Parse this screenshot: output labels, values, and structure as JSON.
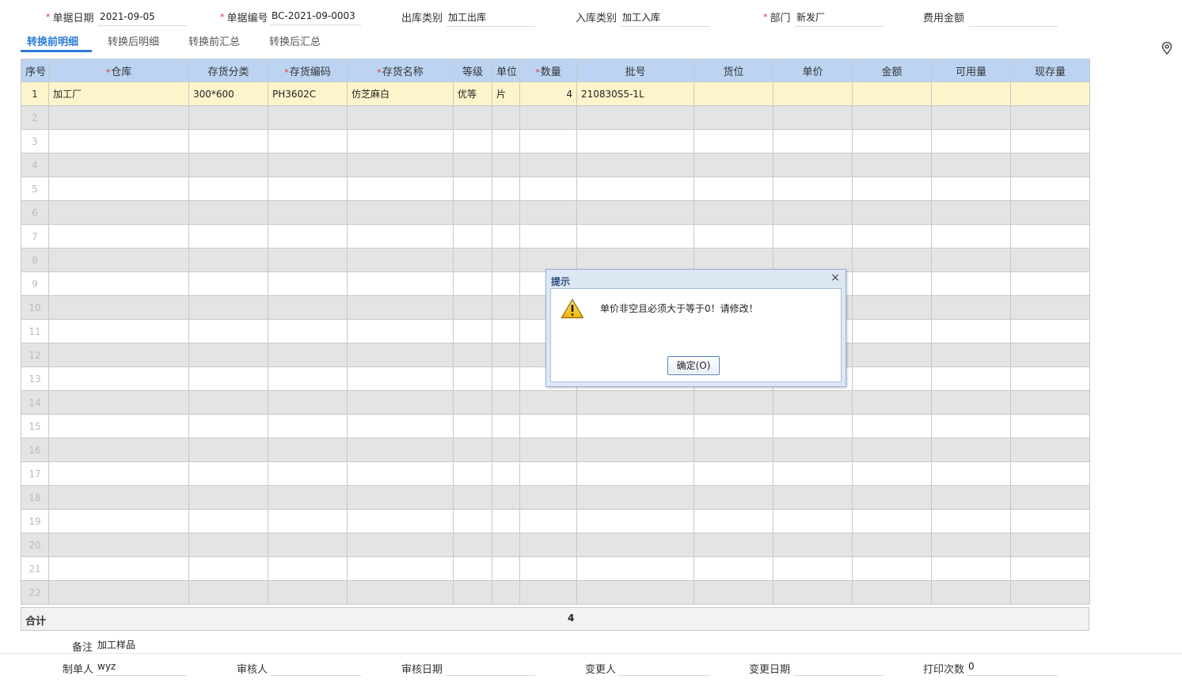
{
  "header": {
    "date": {
      "label": "单据日期",
      "value": "2021-09-05",
      "required": true
    },
    "code": {
      "label": "单据编号",
      "value": "BC-2021-09-0003",
      "required": true
    },
    "out_type": {
      "label": "出库类别",
      "value": "加工出库",
      "required": false
    },
    "in_type": {
      "label": "入库类别",
      "value": "加工入库",
      "required": false
    },
    "dept": {
      "label": "部门",
      "value": "新发厂",
      "required": true
    },
    "fee": {
      "label": "费用金额",
      "value": "",
      "required": false
    }
  },
  "tabs": [
    "转换前明细",
    "转换后明细",
    "转换前汇总",
    "转换后汇总"
  ],
  "active_tab": 0,
  "table": {
    "columns": [
      {
        "label": "序号",
        "required": false
      },
      {
        "label": "仓库",
        "required": true
      },
      {
        "label": "存货分类",
        "required": false
      },
      {
        "label": "存货编码",
        "required": true
      },
      {
        "label": "存货名称",
        "required": true
      },
      {
        "label": "等级",
        "required": false
      },
      {
        "label": "单位",
        "required": false
      },
      {
        "label": "数量",
        "required": true
      },
      {
        "label": "批号",
        "required": false
      },
      {
        "label": "货位",
        "required": false
      },
      {
        "label": "单价",
        "required": false
      },
      {
        "label": "金额",
        "required": false
      },
      {
        "label": "可用量",
        "required": false
      },
      {
        "label": "现存量",
        "required": false
      }
    ],
    "rows": [
      [
        "1",
        "加工厂",
        "300*600",
        "PH3602C",
        "仿芝麻白",
        "优等",
        "片",
        "4",
        "210830S5-1L",
        "",
        "",
        "",
        "",
        ""
      ],
      [
        "2",
        "",
        "",
        "",
        "",
        "",
        "",
        "",
        "",
        "",
        "",
        "",
        "",
        ""
      ],
      [
        "3",
        "",
        "",
        "",
        "",
        "",
        "",
        "",
        "",
        "",
        "",
        "",
        "",
        ""
      ],
      [
        "4",
        "",
        "",
        "",
        "",
        "",
        "",
        "",
        "",
        "",
        "",
        "",
        "",
        ""
      ],
      [
        "5",
        "",
        "",
        "",
        "",
        "",
        "",
        "",
        "",
        "",
        "",
        "",
        "",
        ""
      ],
      [
        "6",
        "",
        "",
        "",
        "",
        "",
        "",
        "",
        "",
        "",
        "",
        "",
        "",
        ""
      ],
      [
        "7",
        "",
        "",
        "",
        "",
        "",
        "",
        "",
        "",
        "",
        "",
        "",
        "",
        ""
      ],
      [
        "8",
        "",
        "",
        "",
        "",
        "",
        "",
        "",
        "",
        "",
        "",
        "",
        "",
        ""
      ],
      [
        "9",
        "",
        "",
        "",
        "",
        "",
        "",
        "",
        "",
        "",
        "",
        "",
        "",
        ""
      ],
      [
        "10",
        "",
        "",
        "",
        "",
        "",
        "",
        "",
        "",
        "",
        "",
        "",
        "",
        ""
      ],
      [
        "11",
        "",
        "",
        "",
        "",
        "",
        "",
        "",
        "",
        "",
        "",
        "",
        "",
        ""
      ],
      [
        "12",
        "",
        "",
        "",
        "",
        "",
        "",
        "",
        "",
        "",
        "",
        "",
        "",
        ""
      ],
      [
        "13",
        "",
        "",
        "",
        "",
        "",
        "",
        "",
        "",
        "",
        "",
        "",
        "",
        ""
      ],
      [
        "14",
        "",
        "",
        "",
        "",
        "",
        "",
        "",
        "",
        "",
        "",
        "",
        "",
        ""
      ],
      [
        "15",
        "",
        "",
        "",
        "",
        "",
        "",
        "",
        "",
        "",
        "",
        "",
        "",
        ""
      ],
      [
        "16",
        "",
        "",
        "",
        "",
        "",
        "",
        "",
        "",
        "",
        "",
        "",
        "",
        ""
      ],
      [
        "17",
        "",
        "",
        "",
        "",
        "",
        "",
        "",
        "",
        "",
        "",
        "",
        "",
        ""
      ],
      [
        "18",
        "",
        "",
        "",
        "",
        "",
        "",
        "",
        "",
        "",
        "",
        "",
        "",
        ""
      ],
      [
        "19",
        "",
        "",
        "",
        "",
        "",
        "",
        "",
        "",
        "",
        "",
        "",
        "",
        ""
      ],
      [
        "20",
        "",
        "",
        "",
        "",
        "",
        "",
        "",
        "",
        "",
        "",
        "",
        "",
        ""
      ],
      [
        "21",
        "",
        "",
        "",
        "",
        "",
        "",
        "",
        "",
        "",
        "",
        "",
        "",
        ""
      ],
      [
        "22",
        "",
        "",
        "",
        "",
        "",
        "",
        "",
        "",
        "",
        "",
        "",
        "",
        ""
      ]
    ],
    "total": {
      "label": "合计",
      "quantity": "4"
    }
  },
  "footer": {
    "remark": {
      "label": "备注",
      "value": "加工样品"
    },
    "maker": {
      "label": "制单人",
      "value": "wyz"
    },
    "auditor": {
      "label": "审核人",
      "value": ""
    },
    "audit_date": {
      "label": "审核日期",
      "value": ""
    },
    "changer": {
      "label": "变更人",
      "value": ""
    },
    "change_date": {
      "label": "变更日期",
      "value": ""
    },
    "print_count": {
      "label": "打印次数",
      "value": "0"
    }
  },
  "dialog": {
    "title": "提示",
    "close": "×",
    "message": "单价非空且必须大于等于0！请修改！",
    "ok_label": "确定(O)"
  },
  "colors": {
    "accent": "#2a7bd6",
    "header_bg": "#bcd4f2",
    "selected_row": "#fdf4cc",
    "required_star": "#e03131"
  },
  "icons": {
    "location": "location-pin-icon",
    "warning": "warning-icon"
  }
}
